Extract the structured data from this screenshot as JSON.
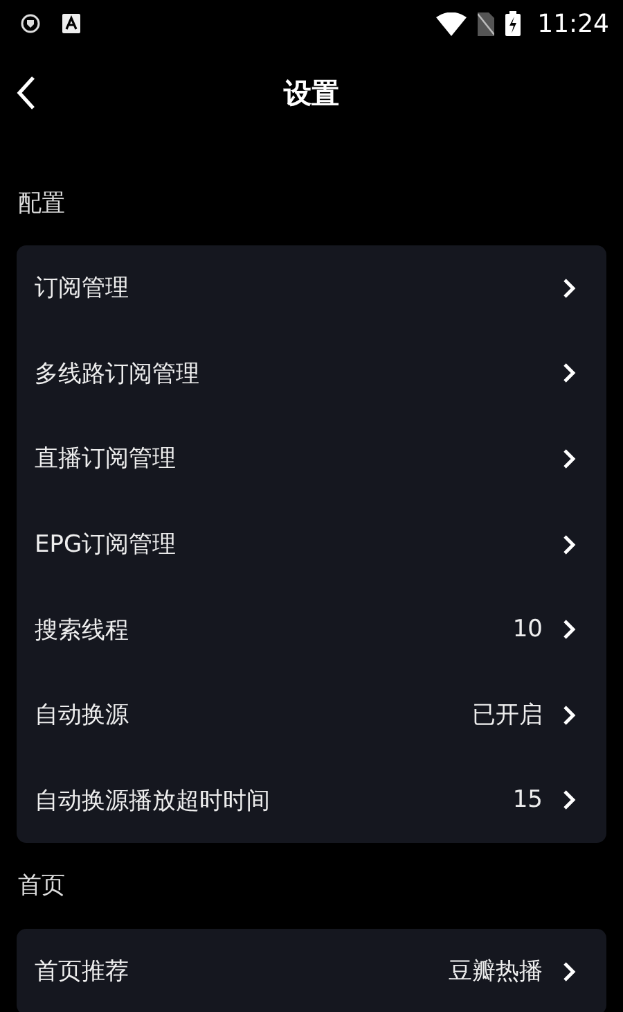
{
  "status_bar": {
    "time": "11:24"
  },
  "header": {
    "title": "设置"
  },
  "sections": [
    {
      "title": "配置",
      "items": [
        {
          "label": "订阅管理"
        },
        {
          "label": "多线路订阅管理"
        },
        {
          "label": "直播订阅管理"
        },
        {
          "label": "EPG订阅管理"
        },
        {
          "label": "搜索线程",
          "value": "10"
        },
        {
          "label": "自动换源",
          "value": "已开启"
        },
        {
          "label": "自动换源播放超时时间",
          "value": "15"
        }
      ]
    },
    {
      "title": "首页",
      "items": [
        {
          "label": "首页推荐",
          "value": "豆瓣热播"
        }
      ]
    }
  ]
}
